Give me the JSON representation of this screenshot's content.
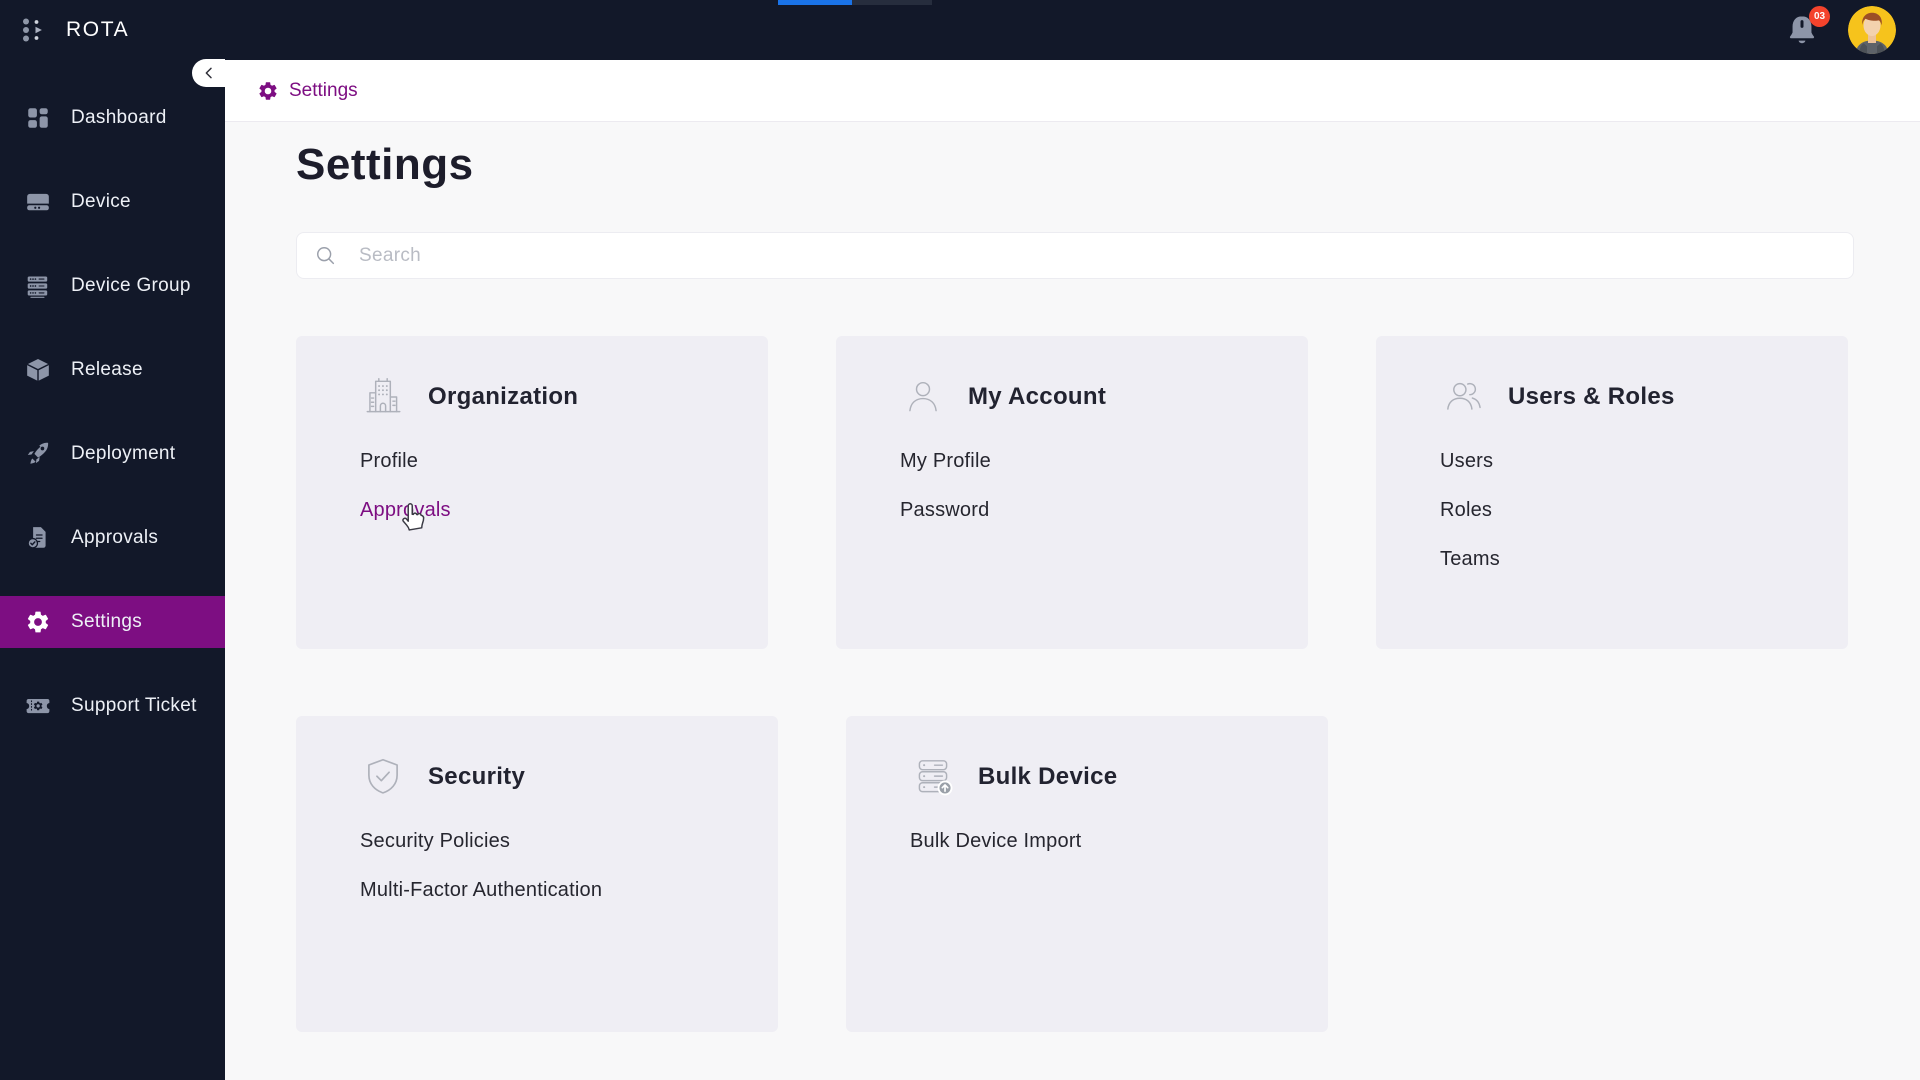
{
  "topbar": {
    "brand": "ROTA",
    "notification_count": "03"
  },
  "sidebar": {
    "items": [
      {
        "label": "Dashboard",
        "icon": "dashboard-icon",
        "active": false
      },
      {
        "label": "Device",
        "icon": "device-icon",
        "active": false
      },
      {
        "label": "Device Group",
        "icon": "device-group-icon",
        "active": false
      },
      {
        "label": "Release",
        "icon": "release-icon",
        "active": false
      },
      {
        "label": "Deployment",
        "icon": "deployment-icon",
        "active": false
      },
      {
        "label": "Approvals",
        "icon": "approvals-icon",
        "active": false
      },
      {
        "label": "Settings",
        "icon": "settings-gear-icon",
        "active": true
      },
      {
        "label": "Support Ticket",
        "icon": "support-ticket-icon",
        "active": false
      }
    ]
  },
  "breadcrumb": {
    "label": "Settings",
    "icon": "gear-icon"
  },
  "page": {
    "title": "Settings"
  },
  "search": {
    "placeholder": "Search"
  },
  "cards": [
    {
      "title": "Organization",
      "icon": "building-icon",
      "links": [
        {
          "label": "Profile"
        },
        {
          "label": "Approvals",
          "state": "hovered"
        }
      ]
    },
    {
      "title": "My Account",
      "icon": "user-icon",
      "links": [
        {
          "label": "My Profile"
        },
        {
          "label": "Password"
        }
      ]
    },
    {
      "title": "Users & Roles",
      "icon": "users-icon",
      "links": [
        {
          "label": "Users"
        },
        {
          "label": "Roles"
        },
        {
          "label": "Teams"
        }
      ]
    },
    {
      "title": "Security",
      "icon": "shield-check-icon",
      "links": [
        {
          "label": "Security Policies"
        },
        {
          "label": "Multi-Factor Authentication"
        }
      ]
    },
    {
      "title": "Bulk Device",
      "icon": "server-upload-icon",
      "links": [
        {
          "label": "Bulk Device Import"
        }
      ]
    }
  ],
  "colors": {
    "accent_purple": "#7d0e82",
    "sidebar_bg": "#121829",
    "badge_red": "#f4432c",
    "avatar_bg": "#f6c31c",
    "top_strip_blue": "#1a73e8",
    "card_bg": "#efeef4",
    "page_bg": "#f8f8f9"
  }
}
